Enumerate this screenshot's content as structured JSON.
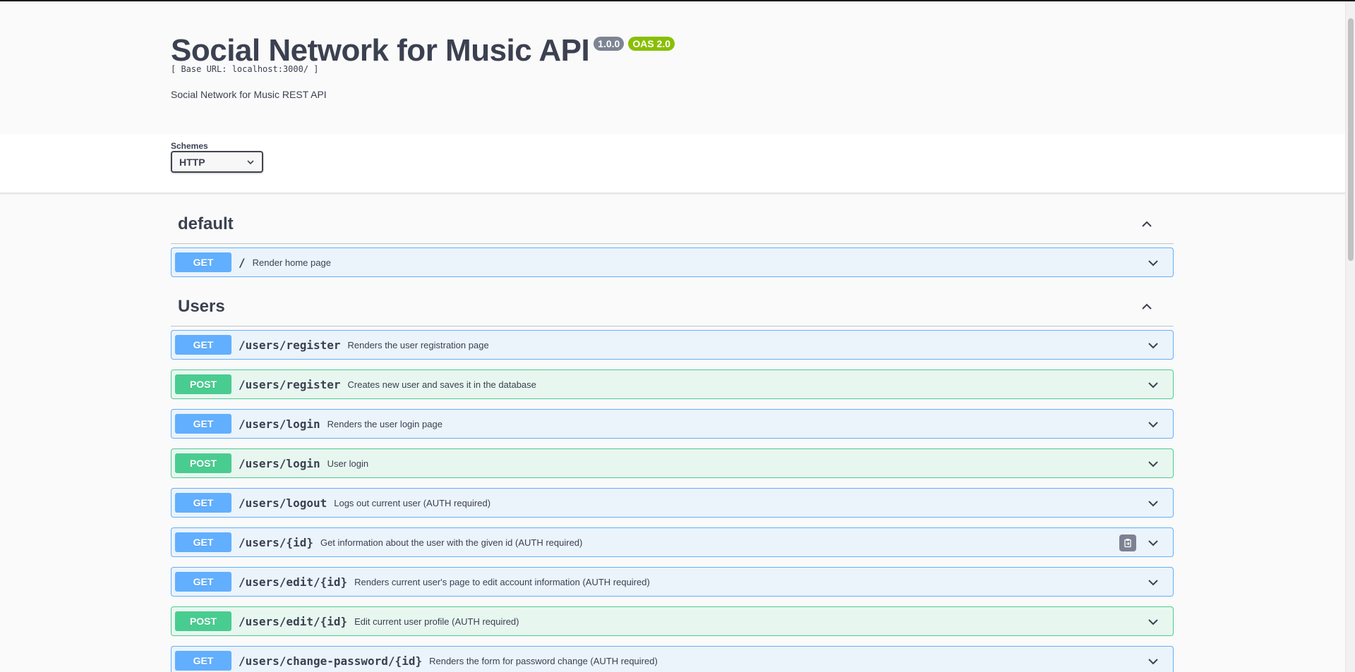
{
  "info": {
    "title": "Social Network for Music API",
    "version_badge": "1.0.0",
    "oas_badge": "OAS 2.0",
    "base_url": "[ Base URL: localhost:3000/ ]",
    "description": "Social Network for Music REST API"
  },
  "schemes": {
    "label": "Schemes",
    "selected": "HTTP"
  },
  "sections": {
    "default": {
      "title": "default",
      "operations": [
        {
          "method": "GET",
          "path": "/",
          "summary": "Render home page"
        }
      ]
    },
    "users": {
      "title": "Users",
      "operations": [
        {
          "method": "GET",
          "path": "/users/register",
          "summary": "Renders the user registration page"
        },
        {
          "method": "POST",
          "path": "/users/register",
          "summary": "Creates new user and saves it in the database"
        },
        {
          "method": "GET",
          "path": "/users/login",
          "summary": "Renders the user login page"
        },
        {
          "method": "POST",
          "path": "/users/login",
          "summary": "User login"
        },
        {
          "method": "GET",
          "path": "/users/logout",
          "summary": "Logs out current user (AUTH required)"
        },
        {
          "method": "GET",
          "path": "/users/{id}",
          "summary": "Get information about the user with the given id (AUTH required)"
        },
        {
          "method": "GET",
          "path": "/users/edit/{id}",
          "summary": "Renders current user's page to edit account information (AUTH required)"
        },
        {
          "method": "POST",
          "path": "/users/edit/{id}",
          "summary": "Edit current user profile (AUTH required)"
        },
        {
          "method": "GET",
          "path": "/users/change-password/{id}",
          "summary": "Renders the form for password change (AUTH required)"
        }
      ]
    }
  },
  "colors": {
    "get": "#61affe",
    "post": "#49cc90",
    "version_badge": "#7d8492",
    "oas_badge": "#89bf04"
  },
  "icons": {
    "collapse": "chevron-up-icon",
    "expand": "chevron-down-icon",
    "copy": "clipboard-icon"
  }
}
